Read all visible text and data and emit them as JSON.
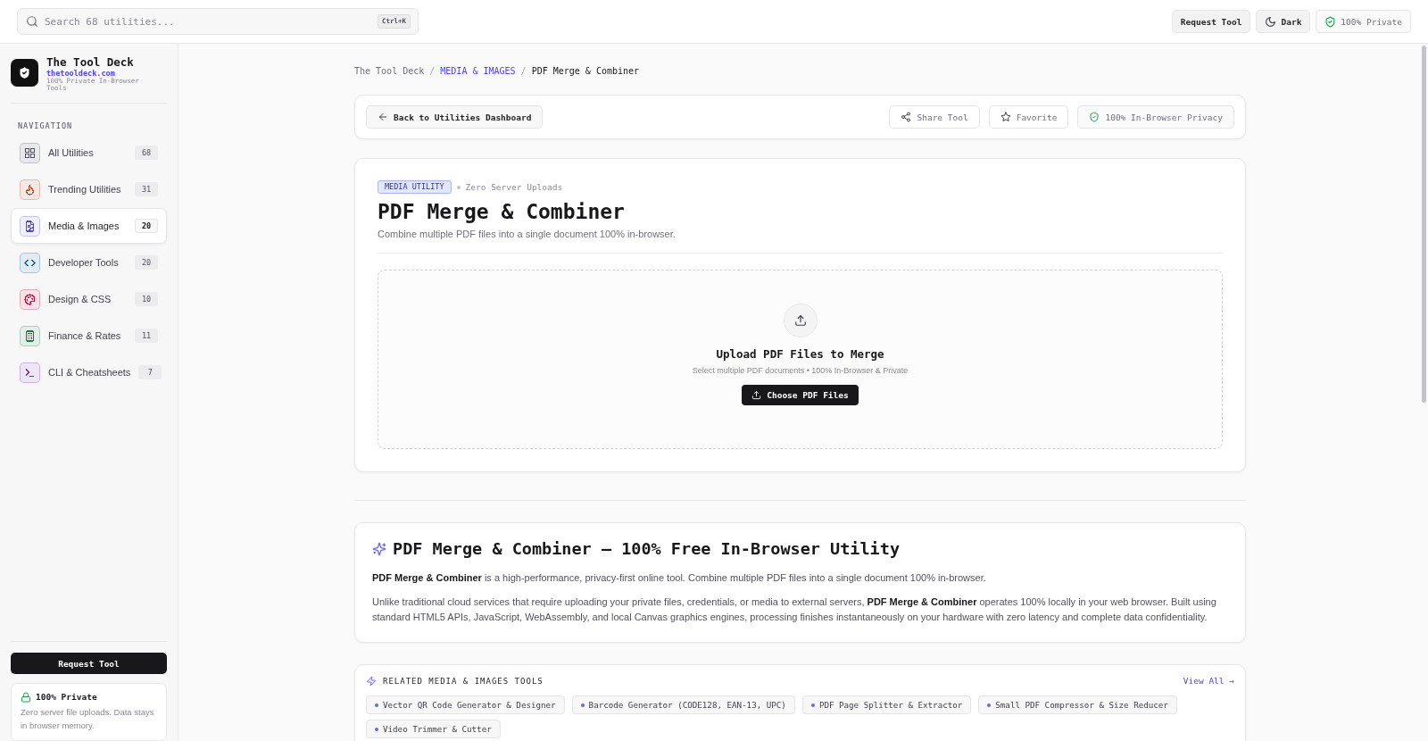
{
  "topbar": {
    "search": {
      "placeholder": "Search 68 utilities...",
      "shortcut": "Ctrl+K"
    },
    "actions": [
      {
        "kind": "button",
        "label": "Request Tool"
      },
      {
        "kind": "theme",
        "label": "Dark"
      },
      {
        "kind": "badge",
        "label": "100% Private"
      }
    ]
  },
  "sidebar": {
    "brand": {
      "name": "The Tool Deck",
      "url": "thetooldeck.com",
      "tagline": "100% Private In-Browser Tools"
    },
    "section": "NAVIGATION",
    "items": [
      {
        "label": "All Utilities",
        "count": "68",
        "color": "#52525b",
        "selected": false
      },
      {
        "label": "Trending Utilities",
        "count": "31",
        "color": "#c2410c",
        "selected": false
      },
      {
        "label": "Media & Images",
        "count": "20",
        "color": "#4f46e5",
        "selected": true
      },
      {
        "label": "Developer Tools",
        "count": "20",
        "color": "#0369a1",
        "selected": false
      },
      {
        "label": "Design & CSS",
        "count": "10",
        "color": "#be123c",
        "selected": false
      },
      {
        "label": "Finance & Rates",
        "count": "11",
        "color": "#15803d",
        "selected": false
      },
      {
        "label": "CLI & Cheatsheets",
        "count": "7",
        "color": "#7e22ce",
        "selected": false
      }
    ],
    "cta": "Request Tool",
    "privacy": {
      "title": "100% Private",
      "text": "Zero server file uploads. Data stays in browser memory."
    }
  },
  "breadcrumb": {
    "separator": "/",
    "items": [
      {
        "kind": "plain",
        "label": "The Tool Deck"
      },
      {
        "kind": "link",
        "label": "MEDIA & IMAGES"
      },
      {
        "kind": "current",
        "label": "PDF Merge & Combiner"
      }
    ]
  },
  "toolbar": {
    "back": "Back to Utilities Dashboard",
    "actions": [
      {
        "kind": "share",
        "label": "Share Tool"
      },
      {
        "kind": "favorite",
        "label": "Favorite"
      },
      {
        "kind": "privacy",
        "label": "100% In-Browser Privacy"
      }
    ]
  },
  "tool": {
    "category": "MEDIA UTILITY",
    "tagline": "Zero Server Uploads",
    "title": "PDF Merge & Combiner",
    "description": "Combine multiple PDF files into a single document 100% in-browser.",
    "dropzone": {
      "title": "Upload PDF Files to Merge",
      "hint": "Select multiple PDF documents • 100% In-Browser & Private",
      "button": "Choose PDF Files"
    }
  },
  "about": {
    "title": "PDF Merge & Combiner — 100% Free In-Browser Utility",
    "paragraphs": [
      "**PDF Merge & Combiner** is a high-performance, privacy-first online tool. Combine multiple PDF files into a single document 100% in-browser.",
      "Unlike traditional cloud services that require uploading your private files, credentials, or media to external servers, **PDF Merge & Combiner** operates 100% locally in your web browser. Built using standard HTML5 APIs, JavaScript, WebAssembly, and local Canvas graphics engines, processing finishes instantaneously on your hardware with zero latency and complete data confidentiality."
    ]
  },
  "related": {
    "title": "RELATED MEDIA & IMAGES TOOLS",
    "link": "View All →",
    "tools": [
      "Vector QR Code Generator & Designer",
      "Barcode Generator (CODE128, EAN-13, UPC)",
      "PDF Page Splitter & Extractor",
      "Small PDF Compressor & Size Reducer",
      "Video Trimmer & Cutter"
    ]
  }
}
